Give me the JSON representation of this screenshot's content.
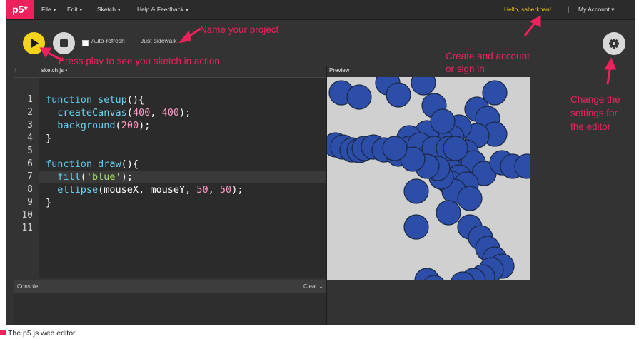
{
  "nav": {
    "logo": "p5*",
    "menus": [
      "File",
      "Edit",
      "Sketch",
      "Help & Feedback"
    ],
    "caret": "▾",
    "user_greeting": "Hello, saberkhan!",
    "separator": "|",
    "account_menu": "My Account ▾"
  },
  "toolbar": {
    "autorefresh_label": "Auto-refresh",
    "project_name": "Just sidewalk",
    "edit_icon": "pencil-icon"
  },
  "annotations": {
    "name_project": "Name your project",
    "press_play": "Press play  to see you sketch in action",
    "create_account_line1": "Create and account",
    "create_account_line2": "or sign in",
    "settings_line1": "Change the",
    "settings_line2": "settings for",
    "settings_line3": "the editor",
    "accent_color": "#ed225d"
  },
  "editor": {
    "file_tab": "sketch.js •",
    "line_numbers": [
      "1",
      "2",
      "3",
      "4",
      "5",
      "6",
      "7",
      "8",
      "9",
      "10",
      "11"
    ],
    "code_lines": [
      [
        {
          "t": "function ",
          "c": "#5fc8e8"
        },
        {
          "t": "setup",
          "c": "#6cd0f0"
        },
        {
          "t": "(){",
          "c": "#ffffff"
        }
      ],
      [
        {
          "t": "  createCanvas",
          "c": "#6cd0f0"
        },
        {
          "t": "(",
          "c": "#ffffff"
        },
        {
          "t": "400",
          "c": "#ff9ec6"
        },
        {
          "t": ", ",
          "c": "#ffffff"
        },
        {
          "t": "400",
          "c": "#ff9ec6"
        },
        {
          "t": ");",
          "c": "#ffffff"
        }
      ],
      [
        {
          "t": "  background",
          "c": "#6cd0f0"
        },
        {
          "t": "(",
          "c": "#ffffff"
        },
        {
          "t": "200",
          "c": "#ff9ec6"
        },
        {
          "t": ");",
          "c": "#ffffff"
        }
      ],
      [
        {
          "t": "}",
          "c": "#ffffff"
        }
      ],
      [],
      [
        {
          "t": "function ",
          "c": "#5fc8e8"
        },
        {
          "t": "draw",
          "c": "#6cd0f0"
        },
        {
          "t": "(){",
          "c": "#ffffff"
        }
      ],
      [
        {
          "t": "  fill",
          "c": "#6cd0f0"
        },
        {
          "t": "(",
          "c": "#ffffff"
        },
        {
          "t": "'blue'",
          "c": "#a8e26b"
        },
        {
          "t": ");",
          "c": "#ffffff"
        }
      ],
      [
        {
          "t": "  ellipse",
          "c": "#6cd0f0"
        },
        {
          "t": "(",
          "c": "#ffffff"
        },
        {
          "t": "mouseX",
          "c": "#ffffff"
        },
        {
          "t": ", ",
          "c": "#ffffff"
        },
        {
          "t": "mouseY",
          "c": "#ffffff"
        },
        {
          "t": ", ",
          "c": "#ffffff"
        },
        {
          "t": "50",
          "c": "#ff9ec6"
        },
        {
          "t": ", ",
          "c": "#ffffff"
        },
        {
          "t": "50",
          "c": "#ff9ec6"
        },
        {
          "t": ");",
          "c": "#ffffff"
        }
      ],
      [
        {
          "t": "}",
          "c": "#ffffff"
        }
      ],
      [],
      []
    ]
  },
  "console": {
    "label": "Console",
    "clear_label": "Clear ⌄"
  },
  "preview": {
    "label": "Preview",
    "canvas_bg": "#d0d0d0",
    "circle_fill": "#2d4ea8",
    "circle_stroke": "#1a2744"
  },
  "caption": "The p5.js web editor"
}
